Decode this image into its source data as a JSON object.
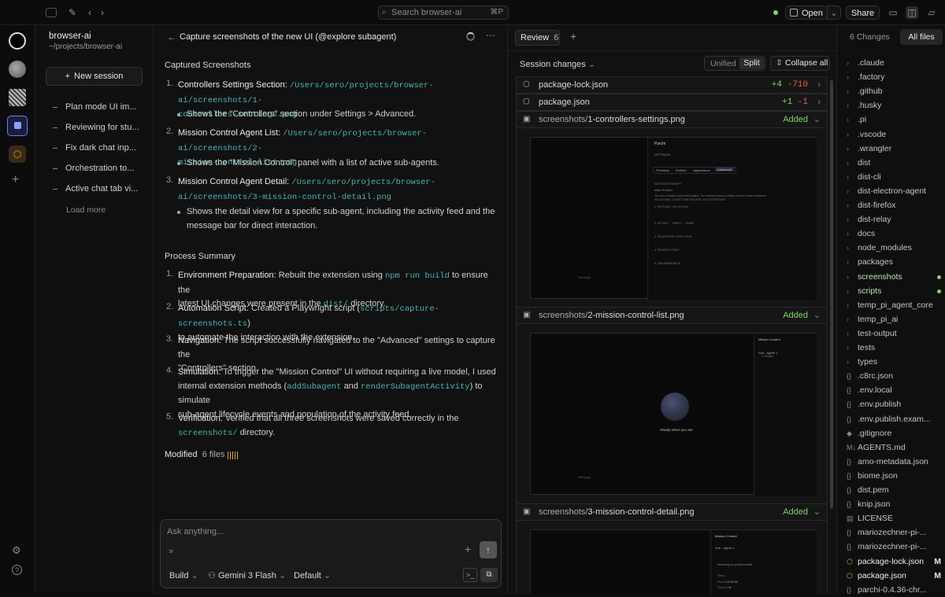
{
  "topbar": {
    "search_placeholder": "Search browser-ai",
    "search_shortcut": "⌘P",
    "open_label": "Open",
    "share_label": "Share"
  },
  "workspace": {
    "name": "browser-ai",
    "path": "~/projects/browser-ai"
  },
  "sidebar": {
    "new_session": "New session",
    "items": [
      {
        "label": "Plan mode UI im..."
      },
      {
        "label": "Reviewing for stu..."
      },
      {
        "label": "Fix dark chat inp..."
      },
      {
        "label": "Orchestration to..."
      },
      {
        "label": "Active chat tab vi..."
      }
    ],
    "load_more": "Load more"
  },
  "chat": {
    "title": "Capture screenshots of the new UI (@explore subagent)",
    "captured_heading": "Captured Screenshots",
    "captured": [
      {
        "num": "1.",
        "title": "Controllers Settings Section:",
        "path1": "/Users/sero/projects/browser-ai/screenshots/1-",
        "path2": "controllers-settings.png",
        "desc": "Shows the \"Controllers\" section under Settings > Advanced."
      },
      {
        "num": "2.",
        "title": "Mission Control Agent List:",
        "path1": "/Users/sero/projects/browser-ai/screenshots/2-",
        "path2": "mission-control-list.png",
        "desc": "Shows the \"Mission Control\" panel with a list of active sub-agents."
      },
      {
        "num": "3.",
        "title": "Mission Control Agent Detail:",
        "path1": "/Users/sero/projects/browser-",
        "path2": "ai/screenshots/3-mission-control-detail.png",
        "desc1": "Shows the detail view for a specific sub-agent, including the activity feed and the",
        "desc2": "message bar for direct interaction."
      }
    ],
    "process_heading": "Process Summary",
    "process": {
      "p1": {
        "num": "1.",
        "title": "Environment Preparation:",
        "a": "Rebuilt the extension using",
        "code": "npm run build",
        "b": "to ensure the",
        "c": "latest UI changes were present in the",
        "code2": "dist/",
        "d": "directory."
      },
      "p2": {
        "num": "2.",
        "title": "Automation Script:",
        "a": "Created a Playwright script (",
        "code": "scripts/capture-screenshots.ts",
        "b": ")",
        "c": "to automate the interaction with the extension."
      },
      "p3": {
        "num": "3.",
        "title": "Navigation:",
        "a": "The script successfully navigated to the \"Advanced\" settings to capture the",
        "b": "\"Controllers\" section."
      },
      "p4": {
        "num": "4.",
        "title": "Simulation:",
        "a": "To trigger the \"Mission Control\" UI without requiring a live model, I used",
        "b": "internal extension methods (",
        "code": "addSubagent",
        "c": "and",
        "code2": "renderSubagentActivity",
        "d": ") to simulate",
        "e": "sub-agent lifecycle events and population of the activity feed."
      },
      "p5": {
        "num": "5.",
        "title": "Verification:",
        "a": "Verified that all three screenshots were saved correctly in the",
        "code": "screenshots/",
        "b": "directory."
      }
    },
    "modified_label": "Modified",
    "modified_count": "6 files",
    "input_placeholder": "Ask anything...",
    "mode": "Build",
    "model": "Gemini 3 Flash",
    "preset": "Default"
  },
  "review": {
    "tab_label": "Review",
    "tab_count": "6",
    "session_changes": "Session changes",
    "unified": "Unified",
    "split": "Split",
    "collapse_all": "Collapse all",
    "files": [
      {
        "name": "package-lock.json",
        "add": "+4",
        "del": "-710"
      },
      {
        "name": "package.json",
        "add": "+1",
        "del": "-1"
      },
      {
        "dir": "screenshots/",
        "name": "1-controllers-settings.png",
        "status": "Added"
      },
      {
        "dir": "screenshots/",
        "name": "2-mission-control-list.png",
        "status": "Added"
      },
      {
        "dir": "screenshots/",
        "name": "3-mission-control-detail.png",
        "status": "Added"
      }
    ],
    "shot1": {
      "app": "Parchi",
      "section": "SETTINGS",
      "tabs": [
        "Providers",
        "Profiles",
        "Appearance",
        "Advanced"
      ],
      "sub": "SYSTEM PROMPT",
      "sub2": "Main Prompt",
      "line1": "You are a browser automation agent. You execute tasks by calling tools in a strict sequence.",
      "line2": "VIOLATIONS CAUSE TASK FAILURE. NO EXCEPTIONS.",
      "h1": "1. NO PLAN = NO ACTION",
      "h2": "2. ACTION → VERIFY → MARK",
      "h3": "3. SEQUENTIAL EXECUTION",
      "h4": "4. EVIDENCE ONLY",
      "h5": "5. TAB AWARENESS",
      "footer": "Message"
    },
    "shot2": {
      "title": "Mission Control",
      "agent": "Sub - Agent 1",
      "agent_sub": "0 minutes",
      "ready": "Ready when you are",
      "footer": "Message"
    },
    "shot3": {
      "title": "Mission Control",
      "agent": "Sub - Agent 1",
      "item": "Searching for product details",
      "label1": "Status",
      "label2": "Started",
      "val2": "00:30:30",
      "label3": "Elapsed",
      "val3": "0s"
    }
  },
  "tree": {
    "tabs": {
      "changes": "6 Changes",
      "all": "All files"
    },
    "folders": [
      ".claude",
      ".factory",
      ".github",
      ".husky",
      ".pi",
      ".vscode",
      ".wrangler",
      "dist",
      "dist-cli",
      "dist-electron-agent",
      "dist-firefox",
      "dist-relay",
      "docs",
      "node_modules",
      "packages",
      "screenshots",
      "scripts",
      "temp_pi_agent_core",
      "temp_pi_ai",
      "test-output",
      "tests",
      "types"
    ],
    "files": [
      ".c8rc.json",
      ".env.local",
      ".env.publish",
      ".env.publish.exam...",
      ".gitignore",
      "AGENTS.md",
      "amo-metadata.json",
      "biome.json",
      "dist.pem",
      "knip.json",
      "LICENSE",
      "mariozechner-pi-...",
      "mariozechner-pi-...",
      "package-lock.json",
      "package.json",
      "parchi-0.4.36-chr..."
    ],
    "modified_marker": "M"
  },
  "colors": {
    "accent_blue": "#6b7cff",
    "added_green": "#7fd36a",
    "deleted_red": "#e0604f",
    "code_teal": "#4fb3b3",
    "warn_orange": "#e6a23c"
  }
}
